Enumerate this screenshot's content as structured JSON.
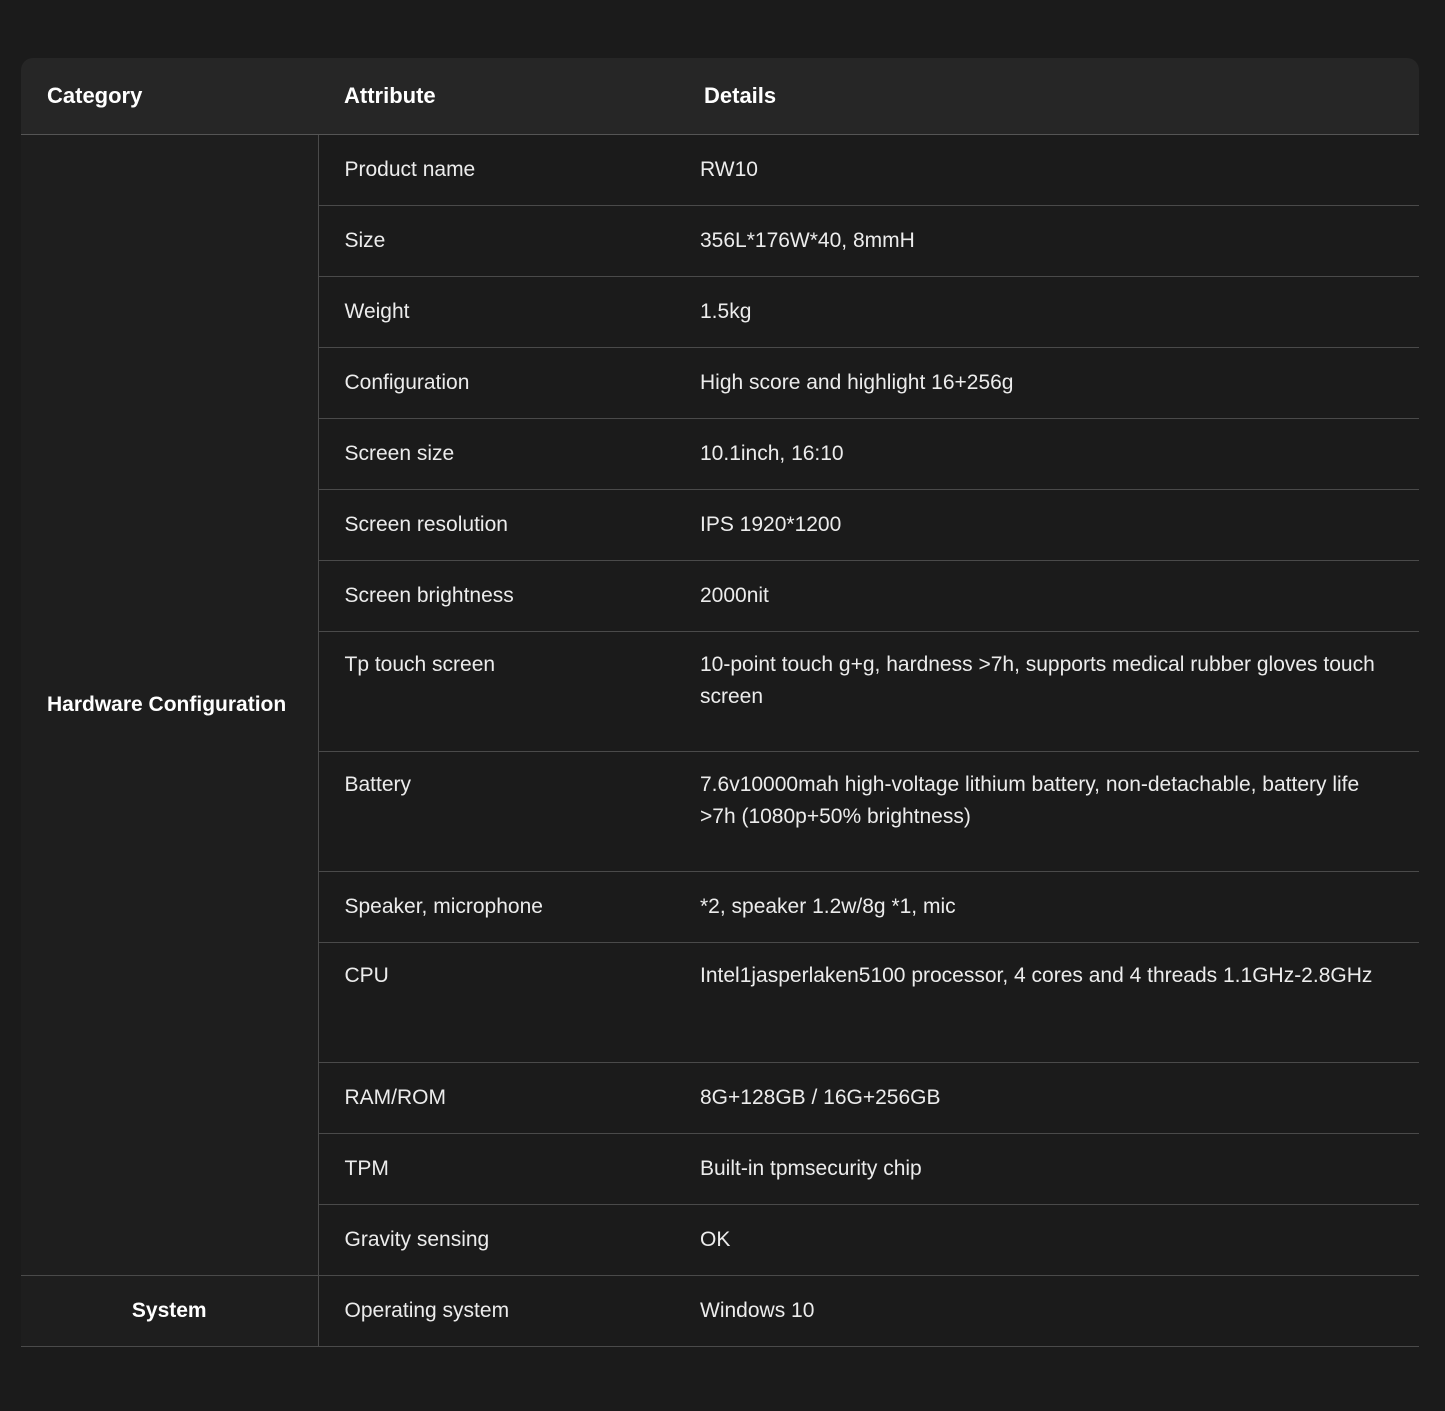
{
  "table": {
    "headers": {
      "category": "Category",
      "attribute": "Attribute",
      "details": "Details"
    },
    "groups": [
      {
        "category": "Hardware Configuration",
        "rows": [
          {
            "attribute": "Product name",
            "details": "RW10"
          },
          {
            "attribute": "Size",
            "details": "356L*176W*40, 8mmH"
          },
          {
            "attribute": "Weight",
            "details": "1.5kg"
          },
          {
            "attribute": "Configuration",
            "details": "High score and highlight 16+256g"
          },
          {
            "attribute": "Screen size",
            "details": "10.1inch, 16:10"
          },
          {
            "attribute": "Screen resolution",
            "details": "IPS 1920*1200"
          },
          {
            "attribute": "Screen brightness",
            "details": "2000nit"
          },
          {
            "attribute": "Tp touch screen",
            "details": "10-point touch g+g, hardness >7h, supports medical rubber gloves touch screen"
          },
          {
            "attribute": "Battery",
            "details": "7.6v10000mah high-voltage lithium battery, non-detachable, battery life >7h (1080p+50% brightness)"
          },
          {
            "attribute": "Speaker, microphone",
            "details": "*2, speaker 1.2w/8g *1, mic"
          },
          {
            "attribute": "CPU",
            "details": "Intel1jasperlaken5100 processor, 4 cores and 4 threads 1.1GHz-2.8GHz"
          },
          {
            "attribute": "RAM/ROM",
            "details": "8G+128GB / 16G+256GB"
          },
          {
            "attribute": "TPM",
            "details": "Built-in tpmsecurity chip"
          },
          {
            "attribute": "Gravity sensing",
            "details": "OK"
          }
        ]
      },
      {
        "category": "System",
        "rows": [
          {
            "attribute": "Operating system",
            "details": "Windows 10"
          }
        ]
      }
    ]
  }
}
